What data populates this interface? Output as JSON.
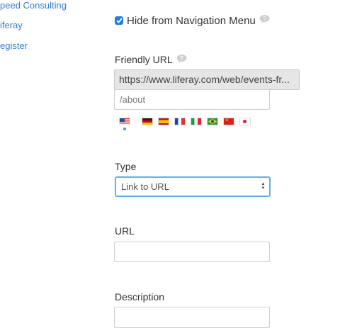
{
  "nav": {
    "items": [
      {
        "label": "peed Consulting"
      },
      {
        "label": "iferay"
      },
      {
        "label": "egister"
      }
    ]
  },
  "form": {
    "hide_nav_label": "Hide from Navigation Menu",
    "hide_nav_checked": true,
    "friendly_url": {
      "label": "Friendly URL",
      "prefix": "https://www.liferay.com/web/events-fr...",
      "value": "/about"
    },
    "language_flags": [
      "us-flag-icon",
      "de-flag-icon",
      "es-flag-icon",
      "fr-flag-icon",
      "it-flag-icon",
      "br-flag-icon",
      "cn-flag-icon",
      "jp-flag-icon"
    ],
    "type": {
      "label": "Type",
      "selected": "Link to URL"
    },
    "url": {
      "label": "URL",
      "value": ""
    },
    "description": {
      "label": "Description",
      "value": ""
    }
  },
  "colors": {
    "link": "#2f7fd0",
    "accent": "#1e7fe6",
    "focus": "#5fb2ef"
  }
}
